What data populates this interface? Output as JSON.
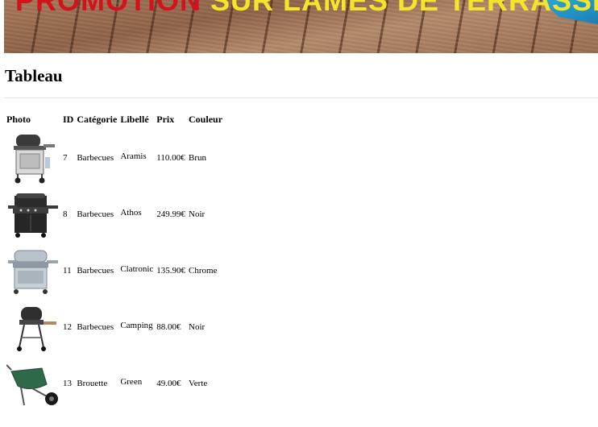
{
  "banner": {
    "text_red": "PROMOTION",
    "text_yellow": "SUR LAMES DE TERRASSE"
  },
  "heading": "Tableau",
  "table": {
    "headers": [
      "Photo",
      "ID",
      "Catégorie",
      "Libellé",
      "Prix",
      "Couleur"
    ],
    "rows": [
      {
        "id": "7",
        "categorie": "Barbecues",
        "libelle": "Aramis",
        "prix": "110.00€",
        "couleur": "Brun",
        "icon": "grill-cart-icon"
      },
      {
        "id": "8",
        "categorie": "Barbecues",
        "libelle": "Athos",
        "prix": "249.99€",
        "couleur": "Noir",
        "icon": "gas-grill-icon"
      },
      {
        "id": "11",
        "categorie": "Barbecues",
        "libelle": "Clatronic",
        "prix": "135.90€",
        "couleur": "Chrome",
        "icon": "chrome-grill-icon"
      },
      {
        "id": "12",
        "categorie": "Barbecues",
        "libelle": "Camping",
        "prix": "88.00€",
        "couleur": "Noir",
        "icon": "camping-grill-icon"
      },
      {
        "id": "13",
        "categorie": "Brouette",
        "libelle": "Green",
        "prix": "49.00€",
        "couleur": "Verte",
        "icon": "wheelbarrow-icon"
      }
    ]
  }
}
